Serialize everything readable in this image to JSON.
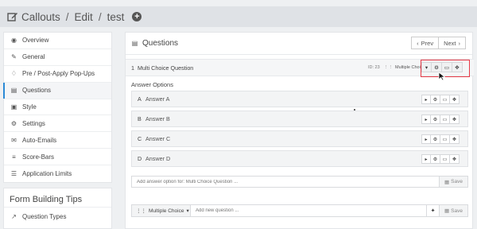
{
  "header": {
    "title": "Callouts",
    "crumb1": "Edit",
    "crumb2": "test",
    "sep": "/",
    "add_icon": "plus-circle-icon"
  },
  "sidebar": {
    "items": [
      {
        "label": "Overview",
        "icon": "dashboard-icon"
      },
      {
        "label": "General",
        "icon": "edit-icon"
      },
      {
        "label": "Pre / Post-Apply Pop-Ups",
        "icon": "bell-icon"
      },
      {
        "label": "Questions",
        "icon": "file-icon"
      },
      {
        "label": "Style",
        "icon": "image-icon"
      },
      {
        "label": "Settings",
        "icon": "cogs-icon"
      },
      {
        "label": "Auto-Emails",
        "icon": "envelope-icon"
      },
      {
        "label": "Score-Bars",
        "icon": "sliders-icon"
      },
      {
        "label": "Application Limits",
        "icon": "list-icon"
      }
    ],
    "active_index": 3
  },
  "tips": {
    "title": "Form Building Tips",
    "item": "Question Types"
  },
  "main": {
    "title": "Questions",
    "prev": "Prev",
    "next": "Next"
  },
  "question": {
    "number": "1",
    "title": "Multi Choice Question",
    "id": "ID: 23",
    "type": "Multiple Choice"
  },
  "answers": {
    "title": "Answer Options",
    "rows": [
      {
        "letter": "A",
        "text": "Answer A"
      },
      {
        "letter": "B",
        "text": "Answer B"
      },
      {
        "letter": "C",
        "text": "Answer C"
      },
      {
        "letter": "D",
        "text": "Answer D"
      }
    ]
  },
  "add_option": {
    "placeholder": "Add answer option for: Multi Choice Question ...",
    "save": "Save"
  },
  "add_question": {
    "type": "Multiple Choice",
    "placeholder": "Add new question ...",
    "save": "Save"
  },
  "colors": {
    "accent": "#2b8ad6",
    "highlight": "#e63946"
  }
}
